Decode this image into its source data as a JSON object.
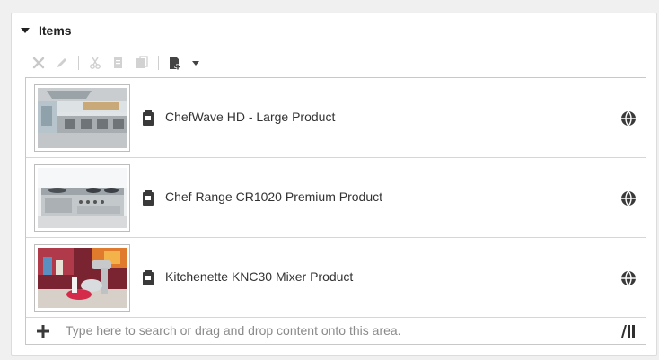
{
  "panel": {
    "title": "Items"
  },
  "toolbar": {
    "buttons": [
      "delete-icon",
      "edit-icon",
      "cut-icon",
      "copy-icon",
      "paste-icon",
      "add-document-icon",
      "dropdown-caret-icon"
    ]
  },
  "items": [
    {
      "title": "ChefWave HD - Large Product",
      "type_icon": "product-icon",
      "status_icon": "globe-icon",
      "thumbnail": "commercial-kitchen-photo"
    },
    {
      "title": "Chef Range CR1020 Premium Product",
      "type_icon": "product-icon",
      "status_icon": "globe-icon",
      "thumbnail": "range-cooker-photo"
    },
    {
      "title": "Kitchenette KNC30 Mixer Product",
      "type_icon": "product-icon",
      "status_icon": "globe-icon",
      "thumbnail": "stand-mixer-photo"
    }
  ],
  "search": {
    "placeholder": "Type here to search or drag and drop content onto this area.",
    "value": ""
  }
}
